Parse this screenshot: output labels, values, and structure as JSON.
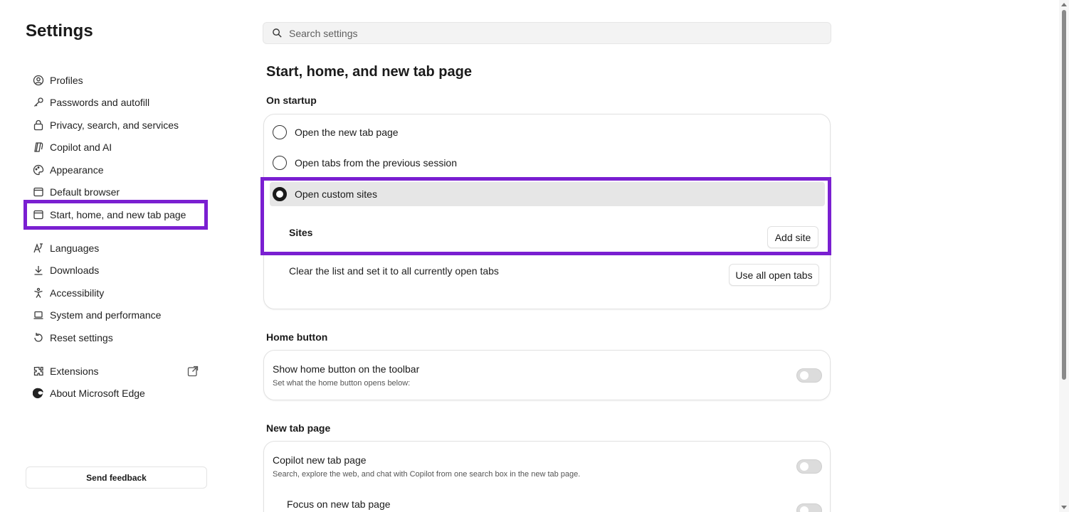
{
  "sidebar": {
    "title": "Settings",
    "items": [
      {
        "label": "Profiles",
        "icon": "profile-icon"
      },
      {
        "label": "Passwords and autofill",
        "icon": "key-icon"
      },
      {
        "label": "Privacy, search, and services",
        "icon": "lock-icon"
      },
      {
        "label": "Copilot and AI",
        "icon": "copilot-icon"
      },
      {
        "label": "Appearance",
        "icon": "palette-icon"
      },
      {
        "label": "Default browser",
        "icon": "browser-icon"
      },
      {
        "label": "Start, home, and new tab page",
        "icon": "home-tab-icon"
      },
      {
        "label": "Languages",
        "icon": "languages-icon"
      },
      {
        "label": "Downloads",
        "icon": "download-icon"
      },
      {
        "label": "Accessibility",
        "icon": "accessibility-icon"
      },
      {
        "label": "System and performance",
        "icon": "laptop-icon"
      },
      {
        "label": "Reset settings",
        "icon": "reset-icon"
      },
      {
        "label": "Extensions",
        "icon": "extensions-icon"
      },
      {
        "label": "About Microsoft Edge",
        "icon": "edge-icon"
      }
    ],
    "feedback_label": "Send feedback"
  },
  "search": {
    "placeholder": "Search settings"
  },
  "main": {
    "page_title": "Start, home, and new tab page",
    "on_startup": {
      "heading": "On startup",
      "options": [
        {
          "label": "Open the new tab page",
          "checked": false
        },
        {
          "label": "Open tabs from the previous session",
          "checked": false
        },
        {
          "label": "Open custom sites",
          "checked": true
        }
      ],
      "sites_label": "Sites",
      "add_site_label": "Add site",
      "clear_text": "Clear the list and set it to all currently open tabs",
      "use_all_label": "Use all open tabs"
    },
    "home_button": {
      "heading": "Home button",
      "title": "Show home button on the toolbar",
      "subtitle": "Set what the home button opens below:"
    },
    "new_tab": {
      "heading": "New tab page",
      "title": "Copilot new tab page",
      "subtitle": "Search, explore the web, and chat with Copilot from one search box in the new tab page.",
      "focus_label": "Focus on new tab page"
    }
  },
  "colors": {
    "highlight": "#7a1fd1"
  }
}
